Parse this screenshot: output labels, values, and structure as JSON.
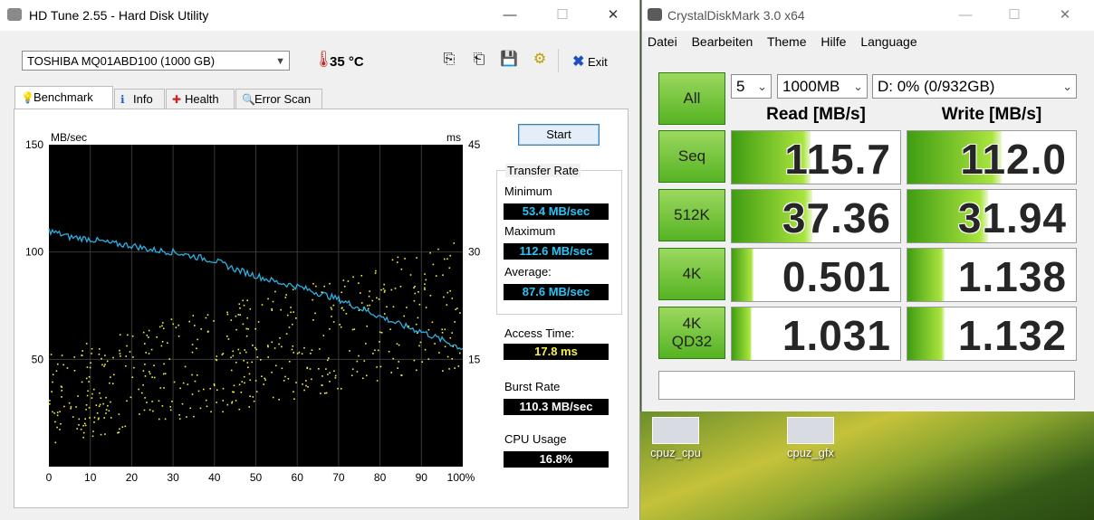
{
  "hdtune": {
    "title": "HD Tune 2.55 - Hard Disk Utility",
    "drive": "TOSHIBA MQ01ABD100 (1000 GB)",
    "temperature": "35 °C",
    "exit_label": "Exit",
    "tabs": [
      {
        "label": "Benchmark",
        "icon": "benchmark-icon"
      },
      {
        "label": "Info",
        "icon": "info-icon"
      },
      {
        "label": "Health",
        "icon": "health-icon"
      },
      {
        "label": "Error Scan",
        "icon": "error-scan-icon"
      }
    ],
    "start_label": "Start",
    "transfer_rate_label": "Transfer Rate",
    "minimum_label": "Minimum",
    "minimum_value": "53.4 MB/sec",
    "maximum_label": "Maximum",
    "maximum_value": "112.6 MB/sec",
    "average_label": "Average:",
    "average_value": "87.6 MB/sec",
    "access_time_label": "Access Time:",
    "access_time_value": "17.8 ms",
    "burst_rate_label": "Burst Rate",
    "burst_rate_value": "110.3 MB/sec",
    "cpu_usage_label": "CPU Usage",
    "cpu_usage_value": "16.8%",
    "chart_data": {
      "type": "line",
      "left_unit": "MB/sec",
      "right_unit": "ms",
      "left_ticks": [
        "150",
        "100",
        "50"
      ],
      "right_ticks": [
        "45",
        "30",
        "15"
      ],
      "x_ticks": [
        "0",
        "10",
        "20",
        "30",
        "40",
        "50",
        "60",
        "70",
        "80",
        "90",
        "100%"
      ],
      "ylim_left": [
        0,
        150
      ],
      "ylim_right": [
        0,
        45
      ],
      "xlim": [
        0,
        100
      ],
      "grid": true,
      "series": [
        {
          "name": "transfer",
          "color": "#2bb0e0",
          "x": [
            0,
            5,
            10,
            15,
            20,
            25,
            30,
            35,
            40,
            45,
            50,
            55,
            60,
            65,
            70,
            75,
            80,
            85,
            90,
            95,
            100
          ],
          "y": [
            110,
            107,
            106,
            104,
            103,
            101,
            100,
            98,
            96,
            92,
            89,
            86,
            84,
            81,
            78,
            74,
            70,
            66,
            63,
            59,
            55
          ]
        },
        {
          "name": "access",
          "color": "#f4f04a",
          "type": "scatter",
          "x_range": [
            0,
            100
          ],
          "y_low": [
            3,
            14
          ],
          "y_high": [
            16,
            32
          ]
        }
      ]
    }
  },
  "cdm": {
    "title": "CrystalDiskMark 3.0 x64",
    "menu": [
      "Datei",
      "Bearbeiten",
      "Theme",
      "Hilfe",
      "Language"
    ],
    "all_label": "All",
    "count": "5",
    "size": "1000MB",
    "drive": "D: 0% (0/932GB)",
    "read_header": "Read [MB/s]",
    "write_header": "Write [MB/s]",
    "rows": [
      {
        "label": "Seq",
        "read": "115.7",
        "write": "112.0",
        "read_fill": 0.47,
        "write_fill": 0.56
      },
      {
        "label": "512K",
        "read": "37.36",
        "write": "31.94",
        "read_fill": 0.48,
        "write_fill": 0.48
      },
      {
        "label": "4K",
        "read": "0.501",
        "write": "1.138",
        "read_fill": 0.13,
        "write_fill": 0.22
      },
      {
        "label": "4K\nQD32",
        "read": "1.031",
        "write": "1.132",
        "read_fill": 0.12,
        "write_fill": 0.22
      }
    ],
    "accent": "#55b322"
  },
  "desktop": {
    "icons": [
      "cpuz_cpu",
      "cpuz_gfx"
    ]
  }
}
